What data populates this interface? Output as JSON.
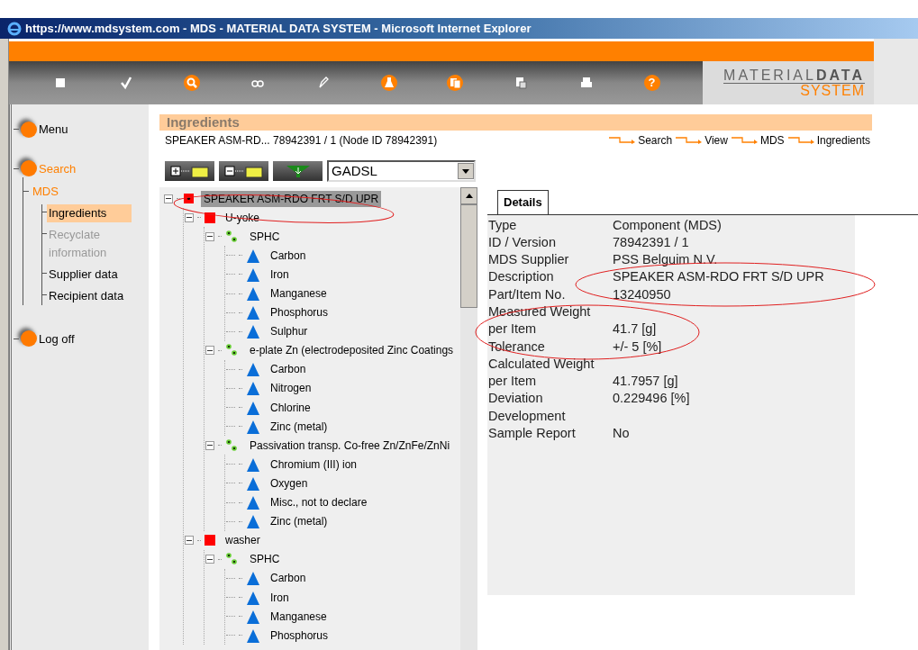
{
  "window": {
    "title": "https://www.mdsystem.com - MDS - MATERIAL DATA SYSTEM - Microsoft Internet Explorer"
  },
  "toolbar": [
    {
      "kind": "save",
      "highlighted": false
    },
    {
      "kind": "check",
      "highlighted": false
    },
    {
      "kind": "search",
      "highlighted": true
    },
    {
      "kind": "glasses",
      "highlighted": false
    },
    {
      "kind": "pen",
      "highlighted": false
    },
    {
      "kind": "flask",
      "highlighted": true
    },
    {
      "kind": "docs",
      "highlighted": true
    },
    {
      "kind": "paste",
      "highlighted": false
    },
    {
      "kind": "print",
      "highlighted": false
    },
    {
      "kind": "help",
      "highlighted": true,
      "label": "?"
    }
  ],
  "logo": {
    "word1": "MATERIAL",
    "word2": "DATA",
    "word3": "SYSTEM"
  },
  "sidebar": [
    {
      "label": "Menu",
      "active": false
    },
    {
      "label": "Search",
      "active": true,
      "children": [
        {
          "label": "MDS",
          "active": true,
          "children": [
            {
              "label": "Ingredients",
              "selected": true,
              "disabled": false
            },
            {
              "label": "Recyclate information",
              "selected": false,
              "disabled": true
            },
            {
              "label": "Supplier data",
              "selected": false,
              "disabled": false
            },
            {
              "label": "Recipient data",
              "selected": false,
              "disabled": false
            }
          ]
        }
      ]
    },
    {
      "label": "Log off",
      "active": false
    }
  ],
  "header": {
    "title": "Ingredients",
    "subtitle": "SPEAKER ASM-RD... 78942391 / 1 (Node ID 78942391)",
    "breadcrumb": [
      "Search",
      "View",
      "MDS",
      "Ingredients"
    ]
  },
  "filter": {
    "value": "GADSL"
  },
  "tree": [
    {
      "label": "SPEAKER ASM-RDO FRT S/D UPR",
      "kind": "assembly",
      "expanded": true,
      "selected": true,
      "children": [
        {
          "label": "U-yoke",
          "kind": "part",
          "expanded": true,
          "selected": false,
          "children": [
            {
              "label": "SPHC",
              "kind": "material",
              "expanded": true,
              "selected": false,
              "children": [
                {
                  "label": "Carbon",
                  "kind": "substance",
                  "selected": false
                },
                {
                  "label": "Iron",
                  "kind": "substance",
                  "selected": false
                },
                {
                  "label": "Manganese",
                  "kind": "substance",
                  "selected": false
                },
                {
                  "label": "Phosphorus",
                  "kind": "substance",
                  "selected": false
                },
                {
                  "label": "Sulphur",
                  "kind": "substance",
                  "selected": false
                }
              ]
            },
            {
              "label": "e-plate Zn (electrodeposited Zinc Coatings",
              "kind": "material",
              "expanded": true,
              "selected": false,
              "children": [
                {
                  "label": "Carbon",
                  "kind": "substance",
                  "selected": false
                },
                {
                  "label": "Nitrogen",
                  "kind": "substance",
                  "selected": false
                },
                {
                  "label": "Chlorine",
                  "kind": "substance",
                  "selected": false
                },
                {
                  "label": "Zinc (metal)",
                  "kind": "substance",
                  "selected": false
                }
              ]
            },
            {
              "label": "Passivation transp. Co-free Zn/ZnFe/ZnNi",
              "kind": "material",
              "expanded": true,
              "selected": false,
              "children": [
                {
                  "label": "Chromium (III) ion",
                  "kind": "substance",
                  "selected": false
                },
                {
                  "label": "Oxygen",
                  "kind": "substance",
                  "selected": false
                },
                {
                  "label": "Misc., not to declare",
                  "kind": "substance",
                  "selected": false
                },
                {
                  "label": "Zinc (metal)",
                  "kind": "substance",
                  "selected": false
                }
              ]
            }
          ]
        },
        {
          "label": "washer",
          "kind": "part",
          "expanded": true,
          "selected": false,
          "children": [
            {
              "label": "SPHC",
              "kind": "material",
              "expanded": true,
              "selected": false,
              "children": [
                {
                  "label": "Carbon",
                  "kind": "substance",
                  "selected": false
                },
                {
                  "label": "Iron",
                  "kind": "substance",
                  "selected": false
                },
                {
                  "label": "Manganese",
                  "kind": "substance",
                  "selected": false
                },
                {
                  "label": "Phosphorus",
                  "kind": "substance",
                  "selected": false
                }
              ]
            }
          ]
        }
      ]
    }
  ],
  "details": {
    "tab": {
      "label": "Details",
      "selected": true
    },
    "rows": [
      {
        "label": "Type",
        "value": "Component (MDS)"
      },
      {
        "label": "ID / Version",
        "value": "78942391 / 1"
      },
      {
        "label": "MDS Supplier",
        "value": "PSS Belguim N.V."
      },
      {
        "label": "Description",
        "value": "SPEAKER ASM-RDO FRT S/D UPR"
      },
      {
        "label": "Part/Item No.",
        "value": "13240950"
      },
      {
        "label": "Measured Weight"
      },
      {
        "label": "per Item",
        "value": "41.7 [g]"
      },
      {
        "label": "Tolerance",
        "value": "+/- 5 [%]"
      },
      {
        "label": "Calculated Weight"
      },
      {
        "label": "per Item",
        "value": "41.7957 [g]"
      },
      {
        "label": "Deviation",
        "value": "0.229496 [%]"
      },
      {
        "label": "Development"
      },
      {
        "label": "Sample Report",
        "value": "No"
      }
    ]
  }
}
